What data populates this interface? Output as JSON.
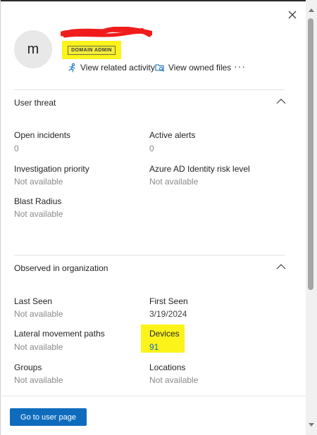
{
  "header": {
    "avatar_initial": "m",
    "role_badge": "DOMAIN ADMIN",
    "actions": {
      "view_related_activity": "View related activity",
      "view_owned_files": "View owned files",
      "more": "···"
    }
  },
  "user_threat": {
    "title": "User threat",
    "fields": {
      "open_incidents": {
        "label": "Open incidents",
        "value": "0"
      },
      "active_alerts": {
        "label": "Active alerts",
        "value": "0"
      },
      "investigation_priority": {
        "label": "Investigation priority",
        "value": "Not available"
      },
      "azure_ad_risk": {
        "label": "Azure AD Identity risk level",
        "value": "Not available"
      },
      "blast_radius": {
        "label": "Blast Radius",
        "value": "Not available"
      }
    }
  },
  "observed": {
    "title": "Observed in organization",
    "fields": {
      "last_seen": {
        "label": "Last Seen",
        "value": "Not available"
      },
      "first_seen": {
        "label": "First Seen",
        "value": "3/19/2024"
      },
      "lateral_movement": {
        "label": "Lateral movement paths",
        "value": "Not available"
      },
      "devices": {
        "label": "Devices",
        "value": "91"
      },
      "groups": {
        "label": "Groups",
        "value": "Not available"
      },
      "locations": {
        "label": "Locations",
        "value": "Not available"
      }
    }
  },
  "footer": {
    "go_to_user_page": "Go to user page"
  },
  "colors": {
    "accent": "#0f6cbd",
    "highlight": "#fbf31a",
    "redaction": "#f01c1c",
    "link_value": "#0f6cbd"
  },
  "icons": [
    "close-icon",
    "activity-icon",
    "owned-files-icon",
    "more-icon",
    "chevron-up-icon"
  ]
}
